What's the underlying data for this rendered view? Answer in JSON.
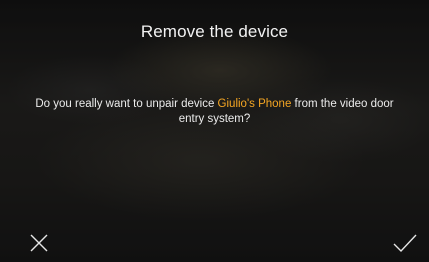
{
  "dialog": {
    "title": "Remove the device",
    "message_before": "Do you really want to unpair device ",
    "device_name": "Giulio's Phone",
    "message_after": " from the video door entry system?"
  },
  "actions": {
    "cancel_icon": "close-icon",
    "confirm_icon": "check-icon"
  },
  "colors": {
    "accent": "#f5a623",
    "text": "#ececec"
  }
}
